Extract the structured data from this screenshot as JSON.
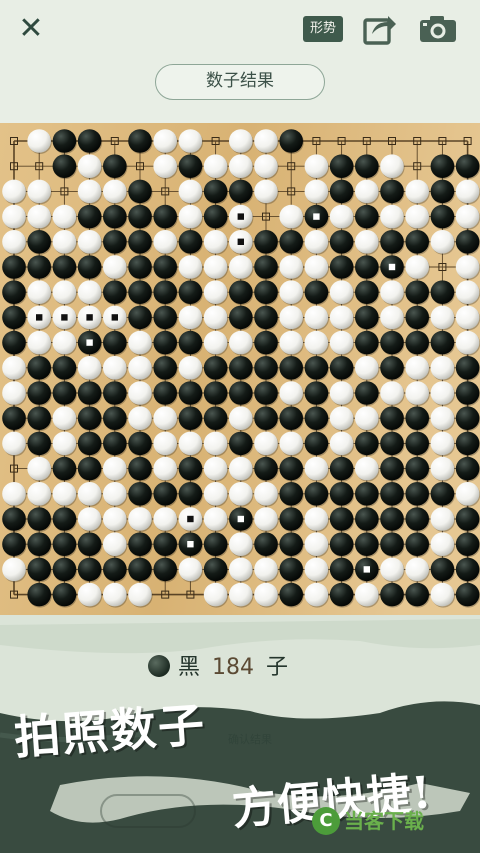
{
  "topbar": {
    "close_label": "✕",
    "situation_badge": "形势",
    "share_icon": "share-icon",
    "camera_icon": "camera-icon",
    "result_button": "数子结果"
  },
  "board": {
    "size": 19,
    "rows": [
      ".WBB.BWW.WWB.......",
      "..BWB.WBWWW.WBBW.BB",
      "WW.WWB.WBBW.WBWBWBW",
      "WWWBBBBWBW.WBWBWWBW",
      "WBWWBBWBWWBBWBWBBWB",
      "BBBBWBBWWWBWWBBBW.W",
      "BWWWBBBBWBBWBWBWBBW",
      "BWWWWBBWWBBWWWBWBWW",
      "BWWBBWBBWWBWWWBBBBW",
      "WBBWWWBWBBBBBBWBWWB",
      "WBBBBWBBBBBWBWBWWWB",
      "BBWBBWWBBWBBBWWBBWB",
      "WBWBBBWWWBWWBWBBBWB",
      ".WBBWBWBWWBBWBWBBWB",
      "WWWWWBBBWWWBBBBBBBW",
      "BBBWWWWWWBWBWBBBBWB",
      "BBBBWBBBBWBBWBBBBWB",
      "WBBBBBBWBWWBWBBWWBB",
      ".BBWWW..WWWBWBWBBWB"
    ],
    "marked_points": [
      [
        3,
        9
      ],
      [
        3,
        12
      ],
      [
        4,
        9
      ],
      [
        5,
        15
      ],
      [
        7,
        1
      ],
      [
        7,
        2
      ],
      [
        7,
        3
      ],
      [
        7,
        4
      ],
      [
        8,
        3
      ],
      [
        15,
        7
      ],
      [
        15,
        9
      ],
      [
        16,
        7
      ],
      [
        17,
        14
      ]
    ],
    "colors": {
      "board": "#dcb779",
      "line": "#5a4426",
      "black_stone": "#141b17",
      "white_stone": "#f2f2ee"
    }
  },
  "score": {
    "side_label": "黑",
    "count": "184",
    "unit": "子"
  },
  "promo": {
    "line1": "拍照数子",
    "line2": "方便快捷!",
    "faint_caption": "确认结果",
    "watermark": "当客下载",
    "watermark_logo": "C"
  }
}
